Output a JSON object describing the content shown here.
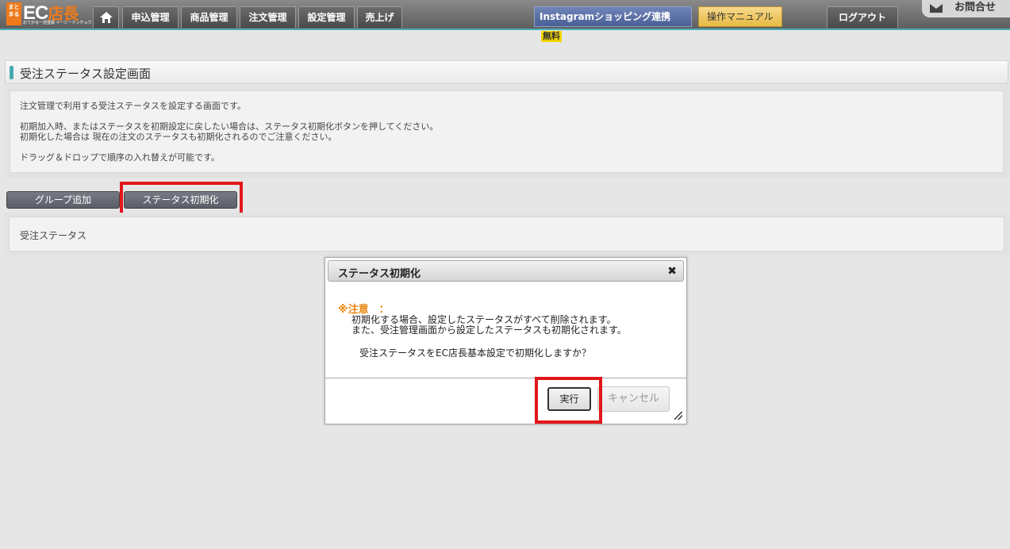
{
  "header": {
    "logo": {
      "badge": "まとまる",
      "main": "EC",
      "accent": "店長",
      "sub": "おてがる一括登録 イーシーテンチョウ"
    },
    "nav": [
      {
        "label": "申込管理"
      },
      {
        "label": "商品管理"
      },
      {
        "label": "注文管理"
      },
      {
        "label": "設定管理"
      },
      {
        "label": "売上げ"
      }
    ],
    "instagram_label": "Instagramショッピング連携",
    "instagram_badge": "無料",
    "manual_label": "操作マニュアル",
    "logout_label": "ログアウト",
    "contact_label": "お問合せ"
  },
  "page": {
    "title": "受注ステータス設定画面",
    "description": [
      "注文管理で利用する受注ステータスを設定する画面です。",
      "初期加入時、またはステータスを初期設定に戻したい場合は、ステータス初期化ボタンを押してください。",
      "初期化した場合は 現在の注文のステータスも初期化されるのでご注意ください。",
      "ドラッグ＆ドロップで順序の入れ替えが可能です。"
    ],
    "add_group_label": "グループ追加",
    "reset_status_label": "ステータス初期化",
    "status_section_label": "受注ステータス"
  },
  "dialog": {
    "title": "ステータス初期化",
    "warning_label": "※注意　：",
    "warning_lines": [
      "初期化する場合、設定したステータスがすべて削除されます。",
      "また、受注管理画面から設定したステータスも初期化されます。"
    ],
    "confirm_text": "受注ステータスをEC店長基本設定で初期化しますか？",
    "execute_label": "実行",
    "cancel_label": "キャンセル"
  },
  "colors": {
    "accent_teal": "#4aa9b0",
    "warning_orange": "#e8860e",
    "highlight_red": "#e2161b",
    "brand_orange": "#ee7a1b"
  }
}
